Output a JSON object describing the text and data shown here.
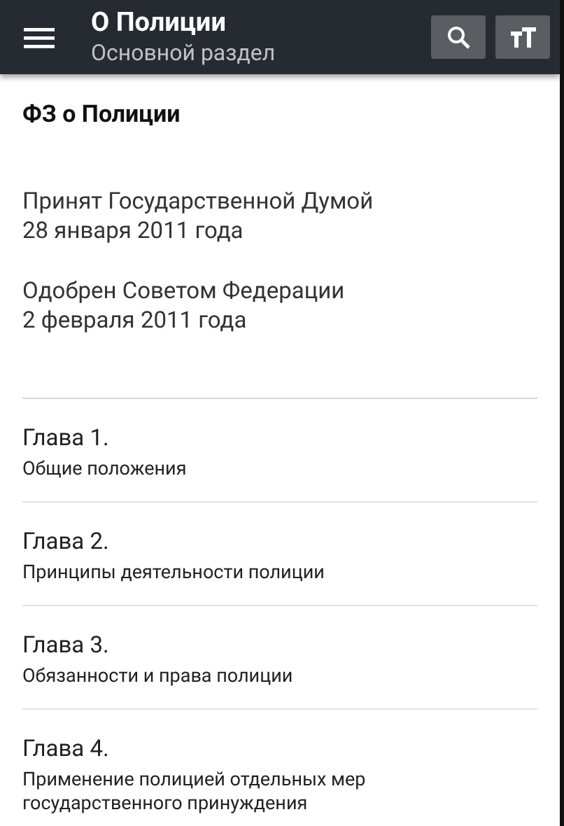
{
  "app_bar": {
    "title": "О Полиции",
    "subtitle": "Основной раздел"
  },
  "document": {
    "heading": "ФЗ о Полиции",
    "paragraphs": [
      [
        "Принят Государственной Думой",
        "28 января  2011 года"
      ],
      [
        "Одобрен Советом Федерации",
        "2 февраля 2011 года"
      ]
    ]
  },
  "chapters": [
    {
      "title": "Глава 1.",
      "subtitle": "Общие положения"
    },
    {
      "title": "Глава 2.",
      "subtitle": "Принципы деятельности полиции"
    },
    {
      "title": "Глава 3.",
      "subtitle": "Обязанности и права полиции"
    },
    {
      "title": "Глава 4.",
      "subtitle": "Применение полицией отдельных мер государственного принуждения"
    }
  ]
}
